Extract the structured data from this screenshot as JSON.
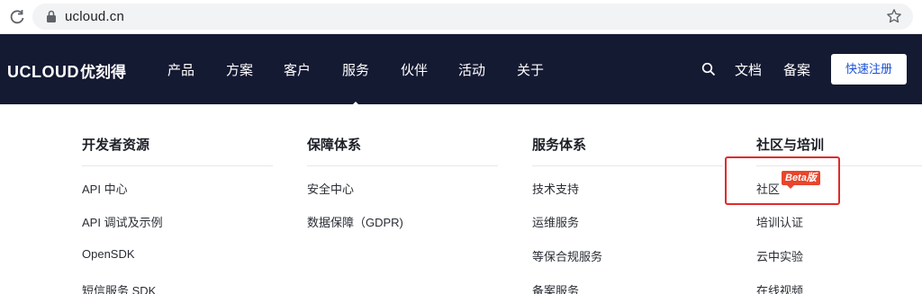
{
  "browser": {
    "url": "ucloud.cn"
  },
  "header": {
    "logo_en": "UCLOUD",
    "logo_cn": "优刻得",
    "nav": [
      "产品",
      "方案",
      "客户",
      "服务",
      "伙伴",
      "活动",
      "关于"
    ],
    "active_nav": "服务",
    "right": {
      "docs": "文档",
      "icp": "备案",
      "register": "快速注册"
    }
  },
  "dropdown": {
    "columns": [
      {
        "title": "开发者资源",
        "items": [
          "API 中心",
          "API 调试及示例",
          "OpenSDK",
          "短信服务 SDK"
        ]
      },
      {
        "title": "保障体系",
        "items": [
          "安全中心",
          "数据保障（GDPR)"
        ]
      },
      {
        "title": "服务体系",
        "items": [
          "技术支持",
          "运维服务",
          "等保合规服务",
          "备案服务"
        ]
      },
      {
        "title": "社区与培训",
        "items": [
          "社区",
          "培训认证",
          "云中实验",
          "在线视频"
        ]
      }
    ],
    "badge": "Beta版"
  },
  "colors": {
    "nav_bg": "#151a33",
    "accent": "#1a4fd6",
    "highlight": "#e02b2b",
    "badge": "#e8452c"
  }
}
